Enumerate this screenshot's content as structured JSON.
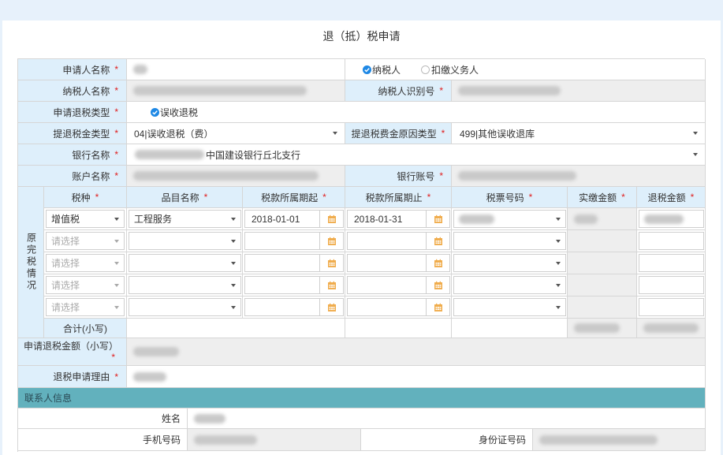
{
  "title": "退（抵）税申请",
  "applicant": {
    "name_label": "申请人名称",
    "role_taxpayer": "纳税人",
    "role_withholding": "扣缴义务人"
  },
  "taxpayer": {
    "name_label": "纳税人名称",
    "id_label": "纳税人识别号"
  },
  "refund_type": {
    "label": "申请退税类型",
    "option": "误收退税"
  },
  "refund_amount_type": {
    "label": "提退税金类型",
    "value": "04|误收退税（费）"
  },
  "reason_type": {
    "label": "提退税费金原因类型",
    "value": "499|其他误收退库"
  },
  "bank": {
    "label": "银行名称",
    "value": "中国建设银行丘北支行"
  },
  "account": {
    "name_label": "账户名称",
    "number_label": "银行账号"
  },
  "original_tax": {
    "side_label": "原完税情况",
    "headers": {
      "tax_type": "税种",
      "item_name": "品目名称",
      "period_start": "税款所属期起",
      "period_end": "税款所属期止",
      "ticket_no": "税票号码",
      "paid_amount": "实缴金额",
      "refund_amount": "退税金额"
    },
    "rows": [
      {
        "tax_type": "增值税",
        "item_name": "工程服务",
        "period_start": "2018-01-01",
        "period_end": "2018-01-31"
      },
      {
        "tax_type": "请选择",
        "item_name": "",
        "period_start": "",
        "period_end": ""
      },
      {
        "tax_type": "请选择",
        "item_name": "",
        "period_start": "",
        "period_end": ""
      },
      {
        "tax_type": "请选择",
        "item_name": "",
        "period_start": "",
        "period_end": ""
      },
      {
        "tax_type": "请选择",
        "item_name": "",
        "period_start": "",
        "period_end": ""
      }
    ],
    "subtotal_label": "合计(小写)"
  },
  "apply_amount": {
    "label": "申请退税金额（小写）"
  },
  "reason": {
    "label": "退税申请理由"
  },
  "contact": {
    "section_label": "联系人信息",
    "name_label": "姓名",
    "phone_label": "手机号码",
    "id_label": "身份证号码"
  },
  "required_mark": "*",
  "colors": {
    "label_bg": "#deeffb",
    "section_bg": "#62b1bd",
    "calendar_icon": "#f0ad4e",
    "check_icon": "#1e88e5",
    "required": "#e02020"
  }
}
